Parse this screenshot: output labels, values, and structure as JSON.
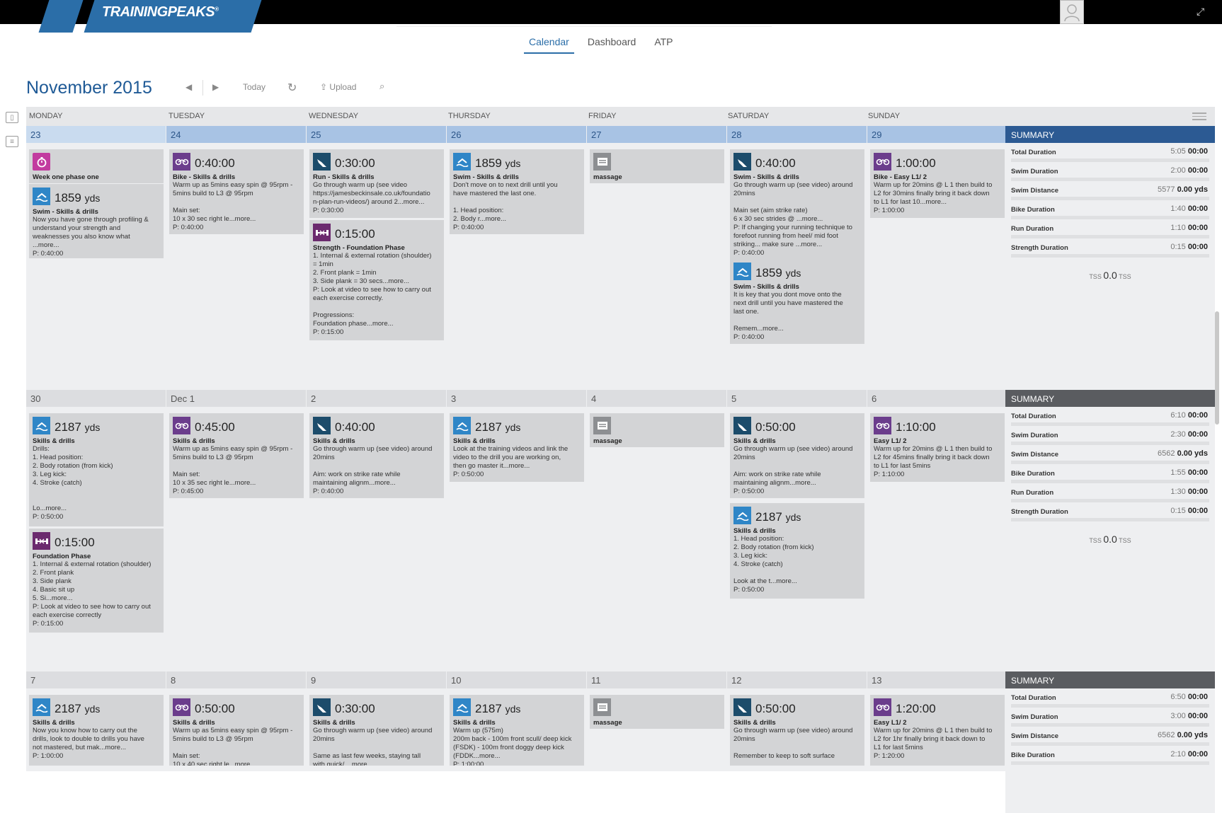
{
  "app": {
    "logo": "TRAININGPEAKS",
    "logo_mark": "®"
  },
  "nav": {
    "tabs": [
      {
        "label": "Calendar"
      },
      {
        "label": "Dashboard"
      },
      {
        "label": "ATP"
      }
    ]
  },
  "header": {
    "month": "November",
    "year": "2015",
    "today": "Today",
    "upload": "Upload"
  },
  "days": [
    "MONDAY",
    "TUESDAY",
    "WEDNESDAY",
    "THURSDAY",
    "FRIDAY",
    "SATURDAY",
    "SUNDAY"
  ],
  "summary_title": "SUMMARY",
  "weeks": [
    {
      "dates": [
        "23",
        "24",
        "25",
        "26",
        "27",
        "28",
        "29"
      ],
      "cards": [
        {
          "icon": "phase-icon",
          "big": "",
          "title": "Week one phase one",
          "desc": ""
        },
        {
          "icon": "swim-icon",
          "big": "1859",
          "unit": "yds",
          "title": "Swim - Skills & drills",
          "desc": "Now you have gone through profiling &\nunderstand your strength and\nweaknesses you also know what\n...more...\nP: 0:40:00"
        },
        {
          "icon": "bike-icon",
          "big": "0:40:00",
          "title": "Bike - Skills & drills",
          "desc": "Warm up as 5mins easy spin @ 95rpm -\n5mins build to L3 @ 95rpm\n\nMain set:\n10 x 30 sec right le...more...\nP: 0:40:00"
        },
        {
          "icon": "run-icon",
          "big": "0:30:00",
          "title": "Run - Skills & drills",
          "desc": "Go through warm up (see video\nhttps://jamesbeckinsale.co.uk/foundatio\nn-plan-run-videos/) around 2...more...\nP: 0:30:00"
        },
        {
          "icon": "strength-icon",
          "big": "0:15:00",
          "title": "Strength - Foundation Phase",
          "desc": "1. Internal & external rotation (shoulder)\n= 1min\n2. Front plank = 1min\n3. Side plank = 30 secs...more...\nP: Look at video to see how to carry out\neach exercise correctly.\n\nProgressions:\nFoundation phase...more...\nP: 0:15:00"
        },
        {
          "icon": "swim-icon",
          "big": "1859",
          "unit": "yds",
          "title": "Swim - Skills & drills",
          "desc": "Don't move on to next drill until you\nhave mastered the last one.\n\n1. Head position:\n2. Body r...more...\nP: 0:40:00"
        },
        {
          "icon": "note-icon",
          "big": "",
          "title": "massage",
          "desc": ""
        },
        {
          "icon": "run-icon",
          "big": "0:40:00",
          "title": "Swim - Skills & drills",
          "desc": "Go through warm up (see video) around\n20mins\n\nMain set (aim strike rate)\n6 x 30 sec strides @ ...more...\nP: If changing your running technique to\nforefoot running from heel/ mid foot\nstriking... make sure ...more...\nP: 0:40:00"
        },
        {
          "icon": "swim-icon",
          "big": "1859",
          "unit": "yds",
          "title": "Swim - Skills & drills",
          "desc": "It is key that you dont move onto the\nnext drill until you have mastered the\nlast one.\n\nRemem...more...\nP: 0:40:00"
        },
        {
          "icon": "bike-icon",
          "big": "1:00:00",
          "title": "Bike - Easy L1/ 2",
          "desc": "Warm up for 20mins @ L 1 then build to\nL2 for 30mins finally bring it back down\nto L1 for last 10...more...\nP: 1:00:00"
        }
      ],
      "summary": [
        {
          "label": "Total Duration",
          "grey": "5:05",
          "bold": "00:00"
        },
        {
          "label": "Swim Duration",
          "grey": "2:00",
          "bold": "00:00"
        },
        {
          "label": "Swim Distance",
          "grey": "5577",
          "bold": "0.00 yds"
        },
        {
          "label": "Bike Duration",
          "grey": "1:40",
          "bold": "00:00"
        },
        {
          "label": "Run Duration",
          "grey": "1:10",
          "bold": "00:00"
        },
        {
          "label": "Strength Duration",
          "grey": "0:15",
          "bold": "00:00"
        }
      ],
      "tss": {
        "pre": "TSS",
        "value": "0.0",
        "post": "TSS"
      }
    },
    {
      "dates": [
        "30",
        "Dec 1",
        "2",
        "3",
        "4",
        "5",
        "6"
      ],
      "cards": [
        {
          "icon": "swim-icon",
          "big": "2187",
          "unit": "yds",
          "title": "Skills & drills",
          "desc": "Drills:\n1. Head position:\n2. Body rotation (from kick)\n3. Leg kick:\n4. Stroke (catch)\n\n\nLo...more...\nP: 0:50:00"
        },
        {
          "icon": "strength-icon",
          "big": "0:15:00",
          "title": "Foundation Phase",
          "desc": "1. Internal & external rotation (shoulder)\n2. Front plank\n3. Side plank\n4. Basic sit up\n5. Si...more...\nP: Look at video to see how to carry out\neach exercise correctly\nP: 0:15:00"
        },
        {
          "icon": "bike-icon",
          "big": "0:45:00",
          "title": "Skills & drills",
          "desc": "Warm up as 5mins easy spin @ 95rpm -\n5mins build to L3 @ 95rpm\n\nMain set:\n10 x 35 sec right le...more...\nP: 0:45:00"
        },
        {
          "icon": "run-icon",
          "big": "0:40:00",
          "title": "Skills & drills",
          "desc": "Go through warm up (see video) around\n20mins\n\nAim: work on strike rate while\nmaintaining alignm...more...\nP: 0:40:00"
        },
        {
          "icon": "swim-icon",
          "big": "2187",
          "unit": "yds",
          "title": "Skills & drills",
          "desc": "Look at the training videos and link the\nvideo to the drill you are working on,\nthen go master it...more...\nP: 0:50:00"
        },
        {
          "icon": "note-icon",
          "big": "",
          "title": "massage",
          "desc": ""
        },
        {
          "icon": "run-icon",
          "big": "0:50:00",
          "title": "Skills & drills",
          "desc": "Go through warm up (see video) around\n20mins\n\nAim: work on strike rate while\nmaintaining alignm...more...\nP: 0:50:00"
        },
        {
          "icon": "swim-icon",
          "big": "2187",
          "unit": "yds",
          "title": "Skills & drills",
          "desc": "1. Head position:\n2. Body rotation (from kick)\n3. Leg kick:\n4. Stroke (catch)\n\nLook at the t...more...\nP: 0:50:00"
        },
        {
          "icon": "bike-icon",
          "big": "1:10:00",
          "title": "Easy L1/ 2",
          "desc": "Warm up for 20mins @ L 1 then build to\nL2 for 45mins finally bring it back down\nto L1 for last 5mins\nP: 1:10:00"
        }
      ],
      "summary": [
        {
          "label": "Total Duration",
          "grey": "6:10",
          "bold": "00:00"
        },
        {
          "label": "Swim Duration",
          "grey": "2:30",
          "bold": "00:00"
        },
        {
          "label": "Swim Distance",
          "grey": "6562",
          "bold": "0.00 yds"
        },
        {
          "label": "Bike Duration",
          "grey": "1:55",
          "bold": "00:00"
        },
        {
          "label": "Run Duration",
          "grey": "1:30",
          "bold": "00:00"
        },
        {
          "label": "Strength Duration",
          "grey": "0:15",
          "bold": "00:00"
        }
      ],
      "tss": {
        "pre": "TSS",
        "value": "0.0",
        "post": "TSS"
      }
    },
    {
      "dates": [
        "7",
        "8",
        "9",
        "10",
        "11",
        "12",
        "13"
      ],
      "cards": [
        {
          "icon": "swim-icon",
          "big": "2187",
          "unit": "yds",
          "title": "Skills & drills",
          "desc": "Now you know how to carry out the\ndrills, look to double to drills you have\nnot mastered, but mak...more...\nP: 1:00:00"
        },
        {
          "icon": "bike-icon",
          "big": "0:50:00",
          "title": "Skills & drills",
          "desc": "Warm up as 5mins easy spin @ 95rpm -\n5mins build to L3 @ 95rpm\n\nMain set:\n10 x 40 sec right le...more..."
        },
        {
          "icon": "run-icon",
          "big": "0:30:00",
          "title": "Skills & drills",
          "desc": "Go through warm up (see video) around\n20mins\n\nSame as last few weeks, staying tall\nwith quick/ ...more..."
        },
        {
          "icon": "swim-icon",
          "big": "2187",
          "unit": "yds",
          "title": "Skills & drills",
          "desc": "Warm up (575m)\n200m back - 100m front scull/ deep kick\n(FSDK) - 100m front doggy deep kick\n(FDDK...more...\nP: 1:00:00"
        },
        {
          "icon": "note-icon",
          "big": "",
          "title": "massage",
          "desc": ""
        },
        {
          "icon": "run-icon",
          "big": "0:50:00",
          "title": "Skills & drills",
          "desc": "Go through warm up (see video) around\n20mins\n\nRemember to keep to soft surface"
        },
        {
          "icon": "bike-icon",
          "big": "1:20:00",
          "title": "Easy L1/ 2",
          "desc": "Warm up for 20mins @ L 1 then build to\nL2 for 1hr finally bring it back down to\nL1 for last 5mins\nP: 1:20:00"
        }
      ],
      "summary": [
        {
          "label": "Total Duration",
          "grey": "6:50",
          "bold": "00:00"
        },
        {
          "label": "Swim Duration",
          "grey": "3:00",
          "bold": "00:00"
        },
        {
          "label": "Swim Distance",
          "grey": "6562",
          "bold": "0.00 yds"
        },
        {
          "label": "Bike Duration",
          "grey": "2:10",
          "bold": "00:00"
        }
      ]
    }
  ]
}
